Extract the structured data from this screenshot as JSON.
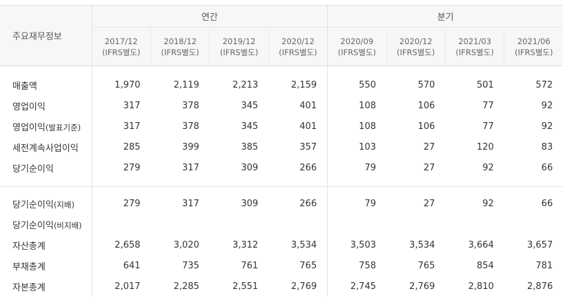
{
  "header": {
    "corner_label": "주요재무정보",
    "group_annual": "연간",
    "group_quarter": "분기",
    "periods": [
      {
        "date": "2017/12",
        "basis": "(IFRS별도)"
      },
      {
        "date": "2018/12",
        "basis": "(IFRS별도)"
      },
      {
        "date": "2019/12",
        "basis": "(IFRS별도)"
      },
      {
        "date": "2020/12",
        "basis": "(IFRS별도)"
      },
      {
        "date": "2020/09",
        "basis": "(IFRS별도)"
      },
      {
        "date": "2020/12",
        "basis": "(IFRS별도)"
      },
      {
        "date": "2021/03",
        "basis": "(IFRS별도)"
      },
      {
        "date": "2021/06",
        "basis": "(IFRS별도)"
      }
    ]
  },
  "rows": [
    {
      "label": "매출액",
      "suffix": "",
      "values": [
        "1,970",
        "2,119",
        "2,213",
        "2,159",
        "550",
        "570",
        "501",
        "572"
      ]
    },
    {
      "label": "영업이익",
      "suffix": "",
      "values": [
        "317",
        "378",
        "345",
        "401",
        "108",
        "106",
        "77",
        "92"
      ]
    },
    {
      "label": "영업이익",
      "suffix": "(발표기준)",
      "values": [
        "317",
        "378",
        "345",
        "401",
        "108",
        "106",
        "77",
        "92"
      ]
    },
    {
      "label": "세전계속사업이익",
      "suffix": "",
      "values": [
        "285",
        "399",
        "385",
        "357",
        "103",
        "27",
        "120",
        "83"
      ]
    },
    {
      "label": "당기순이익",
      "suffix": "",
      "values": [
        "279",
        "317",
        "309",
        "266",
        "79",
        "27",
        "92",
        "66"
      ]
    },
    {
      "label": "당기순이익",
      "suffix": "(지배)",
      "values": [
        "279",
        "317",
        "309",
        "266",
        "79",
        "27",
        "92",
        "66"
      ]
    },
    {
      "label": "당기순이익",
      "suffix": "(비지배)",
      "values": [
        "",
        "",
        "",
        "",
        "",
        "",
        "",
        ""
      ]
    },
    {
      "label": "자산총계",
      "suffix": "",
      "values": [
        "2,658",
        "3,020",
        "3,312",
        "3,534",
        "3,503",
        "3,534",
        "3,664",
        "3,657"
      ]
    },
    {
      "label": "부채총계",
      "suffix": "",
      "values": [
        "641",
        "735",
        "761",
        "765",
        "758",
        "765",
        "854",
        "781"
      ]
    },
    {
      "label": "자본총계",
      "suffix": "",
      "values": [
        "2,017",
        "2,285",
        "2,551",
        "2,769",
        "2,745",
        "2,769",
        "2,810",
        "2,876"
      ]
    }
  ]
}
